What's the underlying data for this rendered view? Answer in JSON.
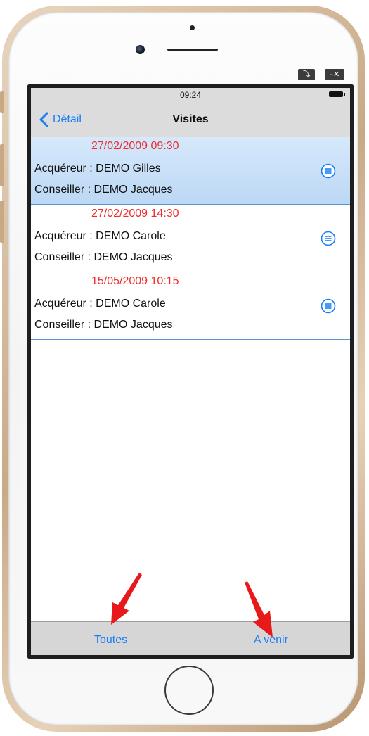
{
  "window_controls": {
    "restore_symbol": "⤵",
    "minimize_close_symbol": "–✕"
  },
  "status_bar": {
    "time": "09:24"
  },
  "nav_bar": {
    "back_label": "Détail",
    "title": "Visites"
  },
  "visits": [
    {
      "datetime": "27/02/2009 09:30",
      "acquereur": "Acquéreur : DEMO Gilles",
      "conseiller": "Conseiller : DEMO Jacques",
      "selected": true
    },
    {
      "datetime": "27/02/2009 14:30",
      "acquereur": "Acquéreur : DEMO Carole",
      "conseiller": "Conseiller : DEMO Jacques",
      "selected": false
    },
    {
      "datetime": "15/05/2009 10:15",
      "acquereur": "Acquéreur : DEMO Carole",
      "conseiller": "Conseiller : DEMO Jacques",
      "selected": false
    }
  ],
  "tab_bar": {
    "all_label": "Toutes",
    "upcoming_label": "A venir"
  },
  "colors": {
    "accent": "#1a7ef5",
    "date": "#ef2b2b",
    "selected_row": "#c9e0f8",
    "annotation_arrow": "#e8191b"
  },
  "icons": {
    "back": "chevron-left-icon",
    "detail": "list-circle-icon",
    "annotation": "red-arrow-icon"
  }
}
